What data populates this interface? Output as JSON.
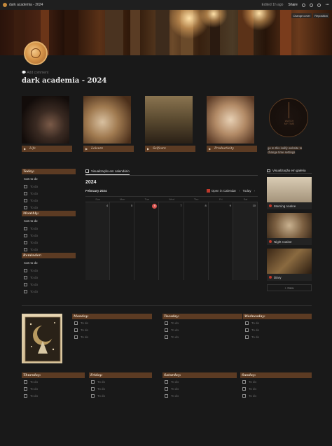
{
  "topbar": {
    "breadcrumb": "dark academia - 2024",
    "edited": "Edited 1h ago",
    "share": "Share"
  },
  "cover": {
    "change_cover": "Change cover",
    "reposition": "Reposition"
  },
  "add_comment": "Add comment",
  "page_title": "dark academia - 2024",
  "top_gallery": [
    {
      "label": "Life"
    },
    {
      "label": "Leisure"
    },
    {
      "label": "Selfcare"
    },
    {
      "label": "Productivity"
    }
  ],
  "clock": {
    "text": "WATCH\nMY TIME",
    "link": "go to this indify website to change time settings"
  },
  "left_sections": [
    {
      "heading": "Today:",
      "nowtodo": "now to do",
      "todos": [
        "To do",
        "To do",
        "To do",
        "To do"
      ]
    },
    {
      "heading": "Monthly:",
      "nowtodo": "now to do",
      "todos": [
        "To do",
        "To do",
        "To do",
        "To do"
      ]
    },
    {
      "heading": "Reminder:",
      "nowtodo": "now to do",
      "todos": [
        "To do",
        "To do",
        "To do",
        "To do"
      ]
    }
  ],
  "calendar": {
    "tab": "Visualização em calendário",
    "year": "2024",
    "month": "February 2024",
    "open_in_calendar": "Open in Calendar",
    "today": "Today",
    "dow": [
      "Sun",
      "Mon",
      "Tue",
      "Wed",
      "Thu",
      "Fri",
      "Sat"
    ],
    "days": [
      "4",
      "5",
      "6",
      "7",
      "8",
      "9",
      "10"
    ],
    "today_index": 2
  },
  "right_gallery": {
    "heading": "Visualização em galeria",
    "cards": [
      "Morning routine",
      "Night routine",
      "Diary"
    ],
    "new": "+ New"
  },
  "week_top": [
    {
      "heading": "Monday:",
      "todos": [
        "To do",
        "To do",
        "To do"
      ]
    },
    {
      "heading": "Tuesday:",
      "todos": [
        "To do",
        "To do",
        "To do"
      ]
    },
    {
      "heading": "Wednesday:",
      "todos": [
        "To do",
        "To do",
        "To do"
      ]
    }
  ],
  "week_bottom": [
    {
      "heading": "Thursday:",
      "todos": [
        "To do",
        "To do",
        "To do"
      ]
    },
    {
      "heading": "Friday:",
      "todos": [
        "To do",
        "To do",
        "To do"
      ]
    },
    {
      "heading": "Saturday:",
      "todos": [
        "To do",
        "To do",
        "To do"
      ]
    },
    {
      "heading": "Sunday:",
      "todos": [
        "To do",
        "To do",
        "To do"
      ]
    }
  ]
}
